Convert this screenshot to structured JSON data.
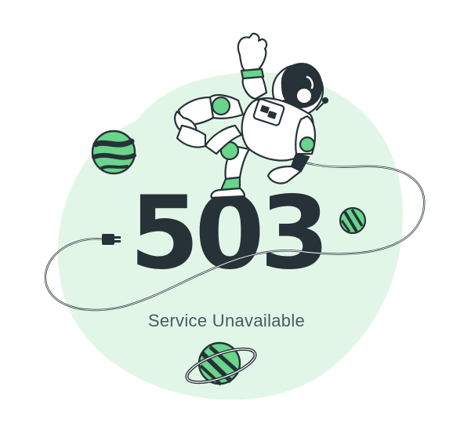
{
  "error": {
    "code": "503",
    "message": "Service Unavailable"
  },
  "illustration": {
    "subject": "astronaut-icon",
    "planets": [
      "planet-icon",
      "planet-icon",
      "ringed-planet-icon"
    ],
    "cable": "cable-icon"
  },
  "colors": {
    "accent_green": "#69d48a",
    "blob_green": "#e2f6e7",
    "text_dark": "#263238",
    "text_gray": "#455a64"
  }
}
